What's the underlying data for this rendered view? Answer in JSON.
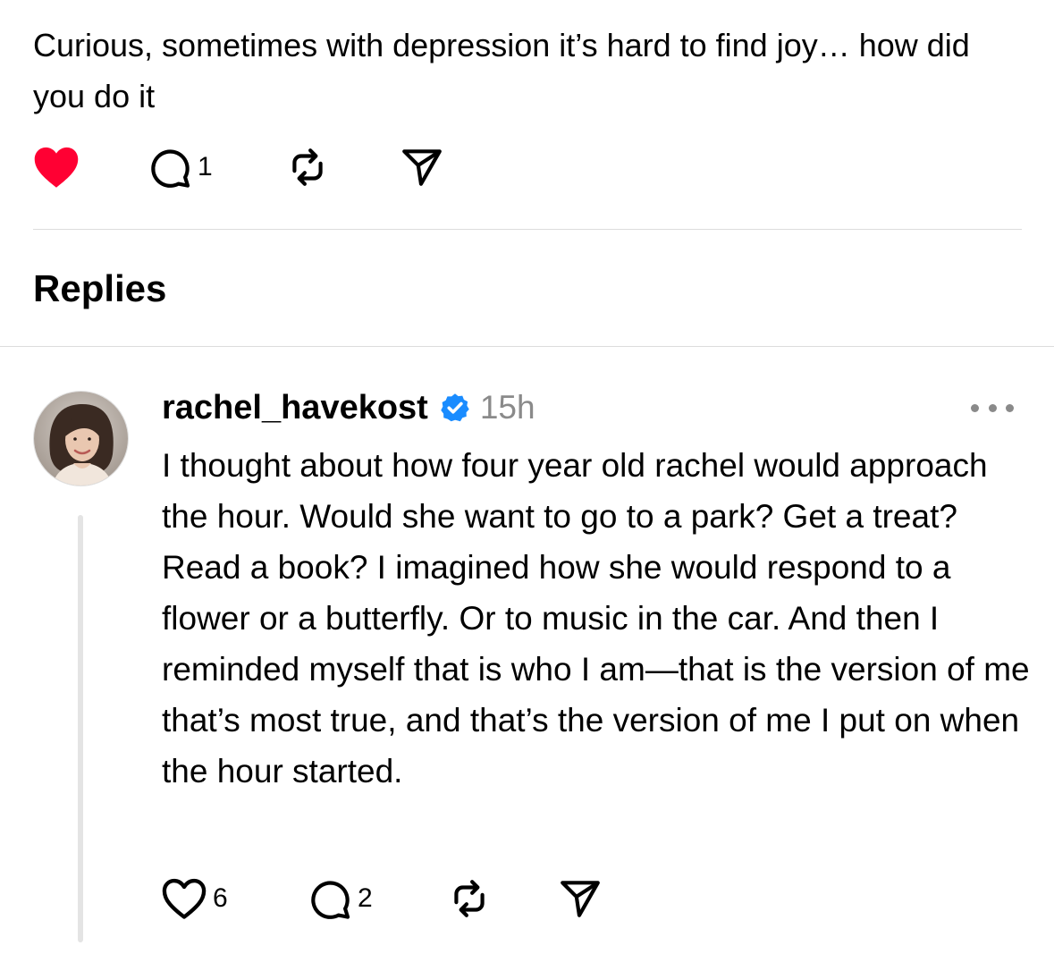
{
  "post": {
    "text": "Curious, sometimes with depression it’s hard to find joy… how did you do it",
    "liked": true,
    "actions": {
      "like_icon": "heart-filled-icon",
      "comment_icon": "comment-icon",
      "comment_count": "1",
      "repost_icon": "repost-icon",
      "share_icon": "send-icon"
    }
  },
  "replies_heading": "Replies",
  "reply": {
    "username": "rachel_havekost",
    "verified": true,
    "timestamp": "15h",
    "more_icon": "more-icon",
    "text": "I thought about how four year old rachel would approach the hour. Would she want to go to a park? Get a treat? Read a book? I imagined how she would respond to a flower or a butterfly. Or to music in the car. And then I reminded myself that is who I am—that is the version of me that’s most true, and that’s the version of me I put on when the hour started.",
    "actions": {
      "like_icon": "heart-outline-icon",
      "like_count": "6",
      "comment_icon": "comment-icon",
      "comment_count": "2",
      "repost_icon": "repost-icon",
      "share_icon": "send-icon"
    }
  },
  "colors": {
    "like_red": "#ff0033",
    "verified_blue": "#1a8cff",
    "muted_gray": "#8a8a8a",
    "divider": "#dcdcdc"
  }
}
